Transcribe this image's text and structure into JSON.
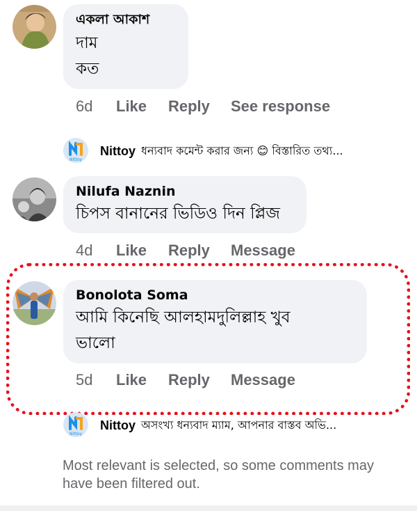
{
  "comments": [
    {
      "author": "একলা আকাশ",
      "text": "দাম\nকত",
      "time": "6d",
      "actions": [
        "Like",
        "Reply",
        "See response"
      ]
    },
    {
      "author": "Nilufa Naznin",
      "text": "চিপস বানানের ভিডিও দিন প্লিজ",
      "time": "4d",
      "actions": [
        "Like",
        "Reply",
        "Message"
      ]
    },
    {
      "author": "Bonolota Soma",
      "text": "আমি কিনেছি আলহামদুলিল্লাহ খুব\nভালো",
      "time": "5d",
      "actions": [
        "Like",
        "Reply",
        "Message"
      ]
    }
  ],
  "replies": [
    {
      "author": "Nittoy",
      "text": "ধন্যবাদ কমেন্ট করার জন্য 😊 বিস্তারিত তথ্য...",
      "avatar_label": "Nittoy"
    },
    {
      "author": "Nittoy",
      "text": "অসংখ্য ধন্যবাদ ম্যাম, আপনার বাস্তব অভি...",
      "avatar_label": "Nittoy"
    }
  ],
  "footer_note": "Most relevant is selected, so some comments may have been filtered out.",
  "colors": {
    "bubble": "#f0f2f5",
    "muted_text": "#65676b",
    "highlight": "#e8101a",
    "nittoy_blue": "#1e90e6",
    "nittoy_orange": "#f7a21b"
  }
}
